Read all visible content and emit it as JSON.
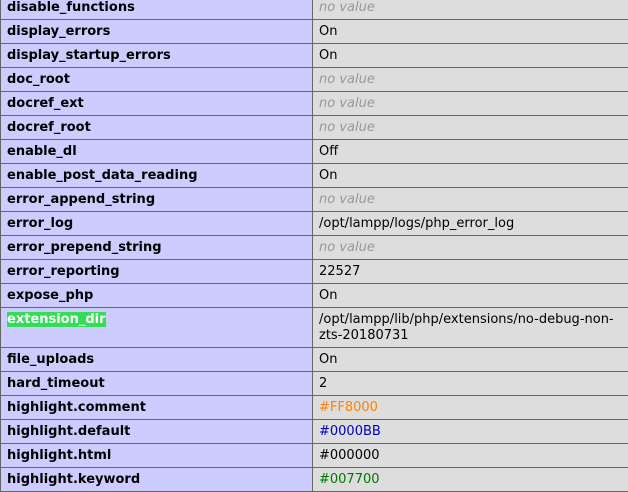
{
  "directives": [
    {
      "name": "disable_functions",
      "value": "no value",
      "no_value": true
    },
    {
      "name": "display_errors",
      "value": "On"
    },
    {
      "name": "display_startup_errors",
      "value": "On"
    },
    {
      "name": "doc_root",
      "value": "no value",
      "no_value": true
    },
    {
      "name": "docref_ext",
      "value": "no value",
      "no_value": true
    },
    {
      "name": "docref_root",
      "value": "no value",
      "no_value": true
    },
    {
      "name": "enable_dl",
      "value": "Off"
    },
    {
      "name": "enable_post_data_reading",
      "value": "On"
    },
    {
      "name": "error_append_string",
      "value": "no value",
      "no_value": true
    },
    {
      "name": "error_log",
      "value": "/opt/lampp/logs/php_error_log"
    },
    {
      "name": "error_prepend_string",
      "value": "no value",
      "no_value": true
    },
    {
      "name": "error_reporting",
      "value": "22527"
    },
    {
      "name": "expose_php",
      "value": "On"
    },
    {
      "name": "extension_dir",
      "value": "/opt/lampp/lib/php/extensions/no-debug-non-zts-20180731",
      "highlighted": true
    },
    {
      "name": "file_uploads",
      "value": "On"
    },
    {
      "name": "hard_timeout",
      "value": "2"
    },
    {
      "name": "highlight.comment",
      "value": "#FF8000",
      "color": "#FF8000"
    },
    {
      "name": "highlight.default",
      "value": "#0000BB",
      "color": "#0000BB"
    },
    {
      "name": "highlight.html",
      "value": "#000000",
      "color": "#000000"
    },
    {
      "name": "highlight.keyword",
      "value": "#007700",
      "color": "#007700"
    }
  ],
  "colors": {
    "directive_bg": "#ccccff",
    "value_bg": "#dddddd",
    "no_value_text": "#999999",
    "search_highlight": "#33dd55"
  }
}
